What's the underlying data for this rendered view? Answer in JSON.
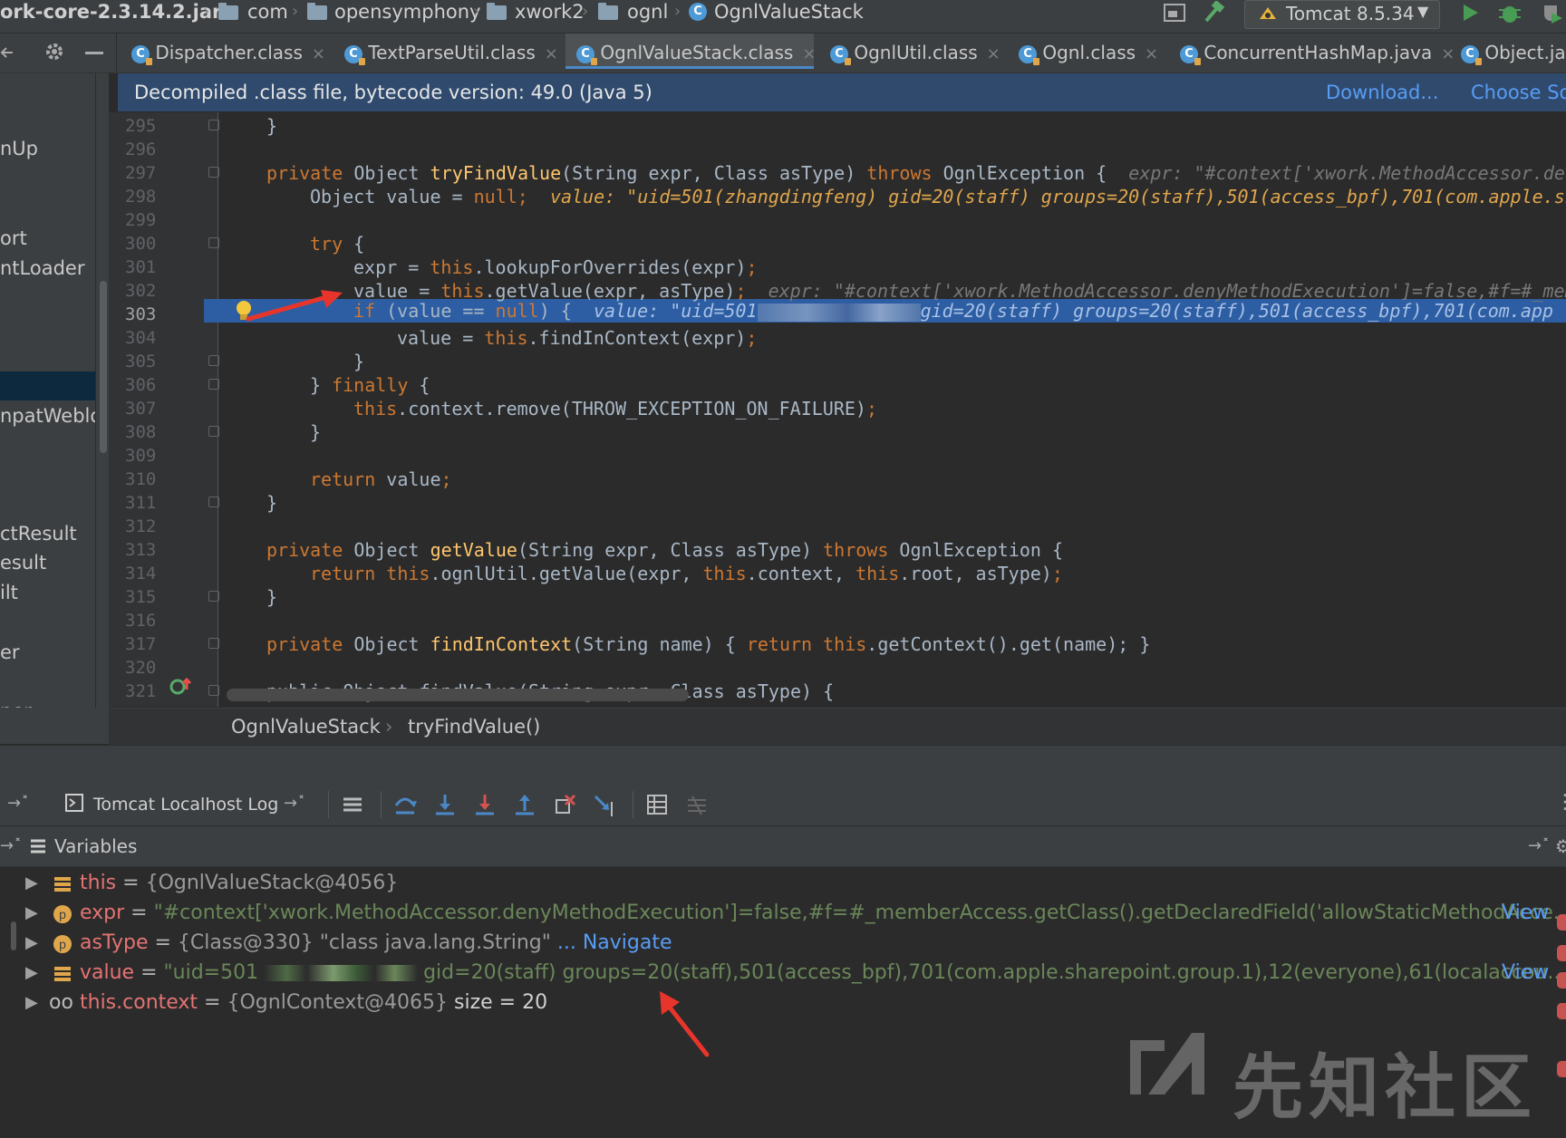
{
  "navbar": {
    "crumbs": [
      "ork-core-2.3.14.2.jar",
      "com",
      "opensymphony",
      "xwork2",
      "ognl",
      "OgnlValueStack"
    ],
    "run_config": "Tomcat 8.5.34"
  },
  "tabs": [
    {
      "label": "Dispatcher.class",
      "active": false
    },
    {
      "label": "TextParseUtil.class",
      "active": false
    },
    {
      "label": "OgnlValueStack.class",
      "active": true
    },
    {
      "label": "OgnlUtil.class",
      "active": false
    },
    {
      "label": "Ognl.class",
      "active": false
    },
    {
      "label": "ConcurrentHashMap.java",
      "active": false
    },
    {
      "label": "Object.jav",
      "active": false
    }
  ],
  "banner": {
    "text": "Decompiled .class file, bytecode version: 49.0 (Java 5)",
    "download": "Download...",
    "choose": "Choose So"
  },
  "left_panel": [
    "nUp",
    "ort",
    "ntLoader",
    "npatWeblo",
    "ctResult",
    "esult",
    "ilt",
    "er",
    "per"
  ],
  "editor": {
    "line_numbers": [
      "295",
      "296",
      "297",
      "298",
      "299",
      "300",
      "301",
      "302",
      "303",
      "304",
      "305",
      "306",
      "307",
      "308",
      "309",
      "310",
      "311",
      "312",
      "313",
      "314",
      "315",
      "316",
      "317",
      "320",
      "321"
    ],
    "current_line": "303",
    "lines": {
      "l295": "}",
      "l297_a": "private ",
      "l297_b": "Object ",
      "l297_c": "tryFindValue",
      "l297_d": "(String expr, Class asType) ",
      "l297_e": "throws ",
      "l297_f": "OgnlException {",
      "l297_hint": "expr: \"#context['xwork.MethodAccessor.der",
      "l298_a": "Object value = ",
      "l298_b": "null",
      "l298_c": ";",
      "l298_hint": "value: \"uid=501(zhangdingfeng) gid=20(staff) groups=20(staff),501(access_bpf),701(com.apple.sh",
      "l300_a": "try ",
      "l300_b": "{",
      "l301_a": "expr = ",
      "l301_b": "this",
      "l301_c": ".lookupForOverrides(expr)",
      "l301_d": ";",
      "l302_a": "value = ",
      "l302_b": "this",
      "l302_c": ".getValue(expr, asType)",
      "l302_d": ";",
      "l302_hint": "expr: \"#context['xwork.MethodAccessor.denyMethodExecution']=false,#f=#_mem",
      "l303_a": "if ",
      "l303_b": "(value == ",
      "l303_c": "null",
      "l303_d": ") {",
      "l303_hint_a": "value: \"uid=501",
      "l303_hint_b": "gid=20(staff) groups=20(staff),501(access_bpf),701(com.app",
      "l304_a": "value = ",
      "l304_b": "this",
      "l304_c": ".findInContext(expr)",
      "l304_d": ";",
      "l305": "}",
      "l306_a": "} ",
      "l306_b": "finally ",
      "l306_c": "{",
      "l307_a": "this",
      "l307_b": ".context.remove(THROW_EXCEPTION_ON_FAILURE)",
      "l307_c": ";",
      "l308": "}",
      "l310_a": "return ",
      "l310_b": "value",
      "l310_c": ";",
      "l311": "}",
      "l313_a": "private ",
      "l313_b": "Object ",
      "l313_c": "getValue",
      "l313_d": "(String expr, Class asType) ",
      "l313_e": "throws ",
      "l313_f": "OgnlException {",
      "l314_a": "return ",
      "l314_b": "this",
      "l314_c": ".ognlUtil.getValue(expr, ",
      "l314_d": "this",
      "l314_e": ".context, ",
      "l314_f": "this",
      "l314_g": ".root, asType)",
      "l314_h": ";",
      "l315": "}",
      "l317_a": "private ",
      "l317_b": "Object ",
      "l317_c": "findInContext",
      "l317_d": "(String name) { ",
      "l317_e": "return ",
      "l317_f": "this",
      "l317_g": ".getContext().get(name)",
      "l317_h": "; }",
      "l321": "public Object findValue(String expr, Class asType) {"
    }
  },
  "editor_breadcrumb": {
    "class": "OgnlValueStack",
    "method": "tryFindValue()"
  },
  "debug": {
    "tab_label": "Tomcat Localhost Log",
    "variables_title": "Variables",
    "vars": [
      {
        "name": "this",
        "eq": " = ",
        "value": "{OgnlValueStack@4056}",
        "link": ""
      },
      {
        "name": "expr",
        "eq": " = ",
        "value": "\"#context['xwork.MethodAccessor.denyMethodExecution']=false,#f=#_memberAccess.getClass().getDeclaredField('allowStaticMethodAcce...",
        "link": "View"
      },
      {
        "name": "asType",
        "eq": " = ",
        "value": "{Class@330} \"class java.lang.String\"",
        "link": "... Navigate"
      },
      {
        "name": "value",
        "eq": " = ",
        "value_a": "\"uid=501",
        "value_b": "gid=20(staff) groups=20(staff),501(access_bpf),701(com.apple.sharepoint.group.1),12(everyone),61(localaccou...",
        "link": "View"
      },
      {
        "name": "this.context",
        "eq": " = ",
        "value": "{OgnlContext@4065}",
        "extra": "size = 20"
      }
    ]
  },
  "watermark": "先知社区",
  "colors": {
    "accent": "#4a88c7",
    "highlight": "#2d5ea3",
    "keyword": "#cc7832",
    "method": "#ffc66d",
    "string": "#6a8759",
    "link": "#589df6"
  }
}
